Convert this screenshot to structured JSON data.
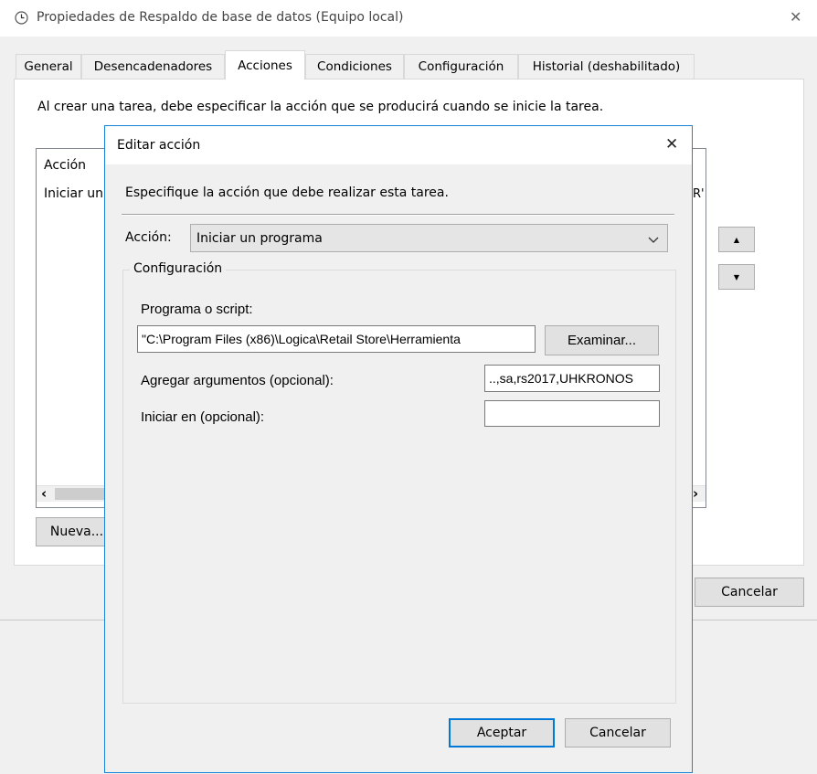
{
  "main_window": {
    "title": "Propiedades de Respaldo de base de datos (Equipo local)",
    "close_glyph": "✕",
    "tabs": [
      {
        "label": "General"
      },
      {
        "label": "Desencadenadores"
      },
      {
        "label": "Acciones"
      },
      {
        "label": "Condiciones"
      },
      {
        "label": "Configuración"
      },
      {
        "label": "Historial (deshabilitado)"
      }
    ],
    "active_tab": "Acciones",
    "description": "Al crear una tarea, debe especificar la acción que se producirá cuando se inicie la tarea.",
    "list": {
      "header_col": "Acción",
      "header_col_partial": "R'",
      "row_partial": "Iniciar un"
    },
    "scroll_left_glyph": "‹",
    "scroll_right_glyph": "›",
    "move_up_glyph": "▲",
    "move_down_glyph": "▼",
    "new_button": "Nueva...",
    "cancel_button": "Cancelar"
  },
  "dialog": {
    "title": "Editar acción",
    "close_glyph": "✕",
    "instruction": "Especifique la acción que debe realizar esta tarea.",
    "action_label": "Acción:",
    "action_value": "Iniciar un programa",
    "config_group": "Configuración",
    "program_label": "Programa o script:",
    "program_value": "\"C:\\Program Files (x86)\\Logica\\Retail Store\\Herramienta",
    "browse_button": "Examinar...",
    "args_label": "Agregar argumentos (opcional):",
    "args_value": "..,sa,rs2017,UHKRONOS",
    "start_label": "Iniciar en (opcional):",
    "start_value": "",
    "ok_button": "Aceptar",
    "cancel_button": "Cancelar"
  },
  "colors": {
    "dialog_border": "#1883d7",
    "default_button_border": "#0078d7",
    "window_bg": "#f0f0f0"
  }
}
